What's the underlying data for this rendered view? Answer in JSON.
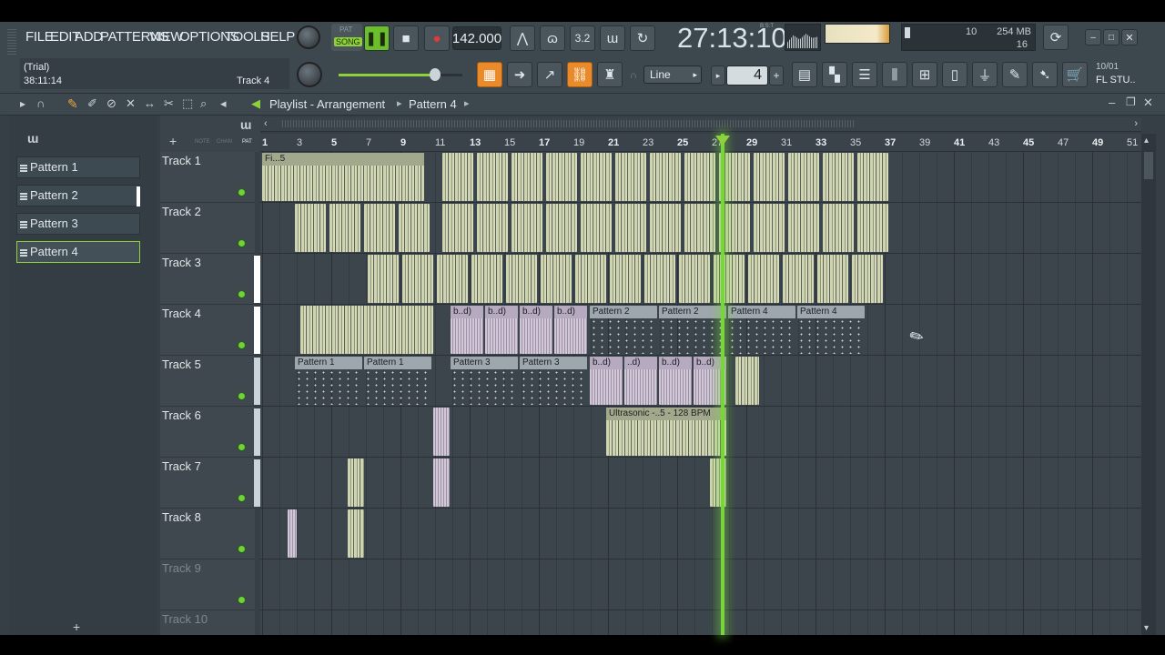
{
  "menu": [
    "FILE",
    "EDIT",
    "ADD",
    "PATTERNS",
    "VIEW",
    "OPTIONS",
    "TOOLS",
    "HELP"
  ],
  "transport": {
    "pat_label": "PAT",
    "song_label": "SONG",
    "tempo": "142.000",
    "time_main": "27:13:10",
    "time_unit": "B:S:T"
  },
  "status": {
    "trial": "(Trial)",
    "time": "38:11:14",
    "track": "Track 4",
    "cpu": "10",
    "mem": "254 MB",
    "poly": "16",
    "news": "10/01",
    "news2": "FL STU.."
  },
  "toolbar2": {
    "snap_mode": "Line",
    "step": "4"
  },
  "playlist": {
    "title": "Playlist - Arrangement",
    "pattern": "Pattern 4",
    "patterns": [
      "Pattern 1",
      "Pattern 2",
      "Pattern 3",
      "Pattern 4"
    ],
    "header_labels": {
      "note": "NOTE",
      "chan": "CHAN",
      "pat": "PAT"
    },
    "ruler": [
      "1",
      "3",
      "5",
      "7",
      "9",
      "11",
      "13",
      "15",
      "17",
      "19",
      "21",
      "23",
      "25",
      "27",
      "29",
      "31",
      "33",
      "35",
      "37",
      "39",
      "41",
      "43",
      "45",
      "47",
      "49",
      "51"
    ],
    "tracks": [
      "Track 1",
      "Track 2",
      "Track 3",
      "Track 4",
      "Track 5",
      "Track 6",
      "Track 7",
      "Track 8",
      "Track 9",
      "Track 10"
    ],
    "clips": {
      "fi": "Fi...5",
      "bd": "b..d)",
      "p1": "Pattern 1",
      "p2": "Pattern 2",
      "p3": "Pattern 3",
      "p4": "Pattern 4",
      "ultra": "Ultrasonic -..5 - 128 BPM",
      "dots": "..d)"
    }
  }
}
